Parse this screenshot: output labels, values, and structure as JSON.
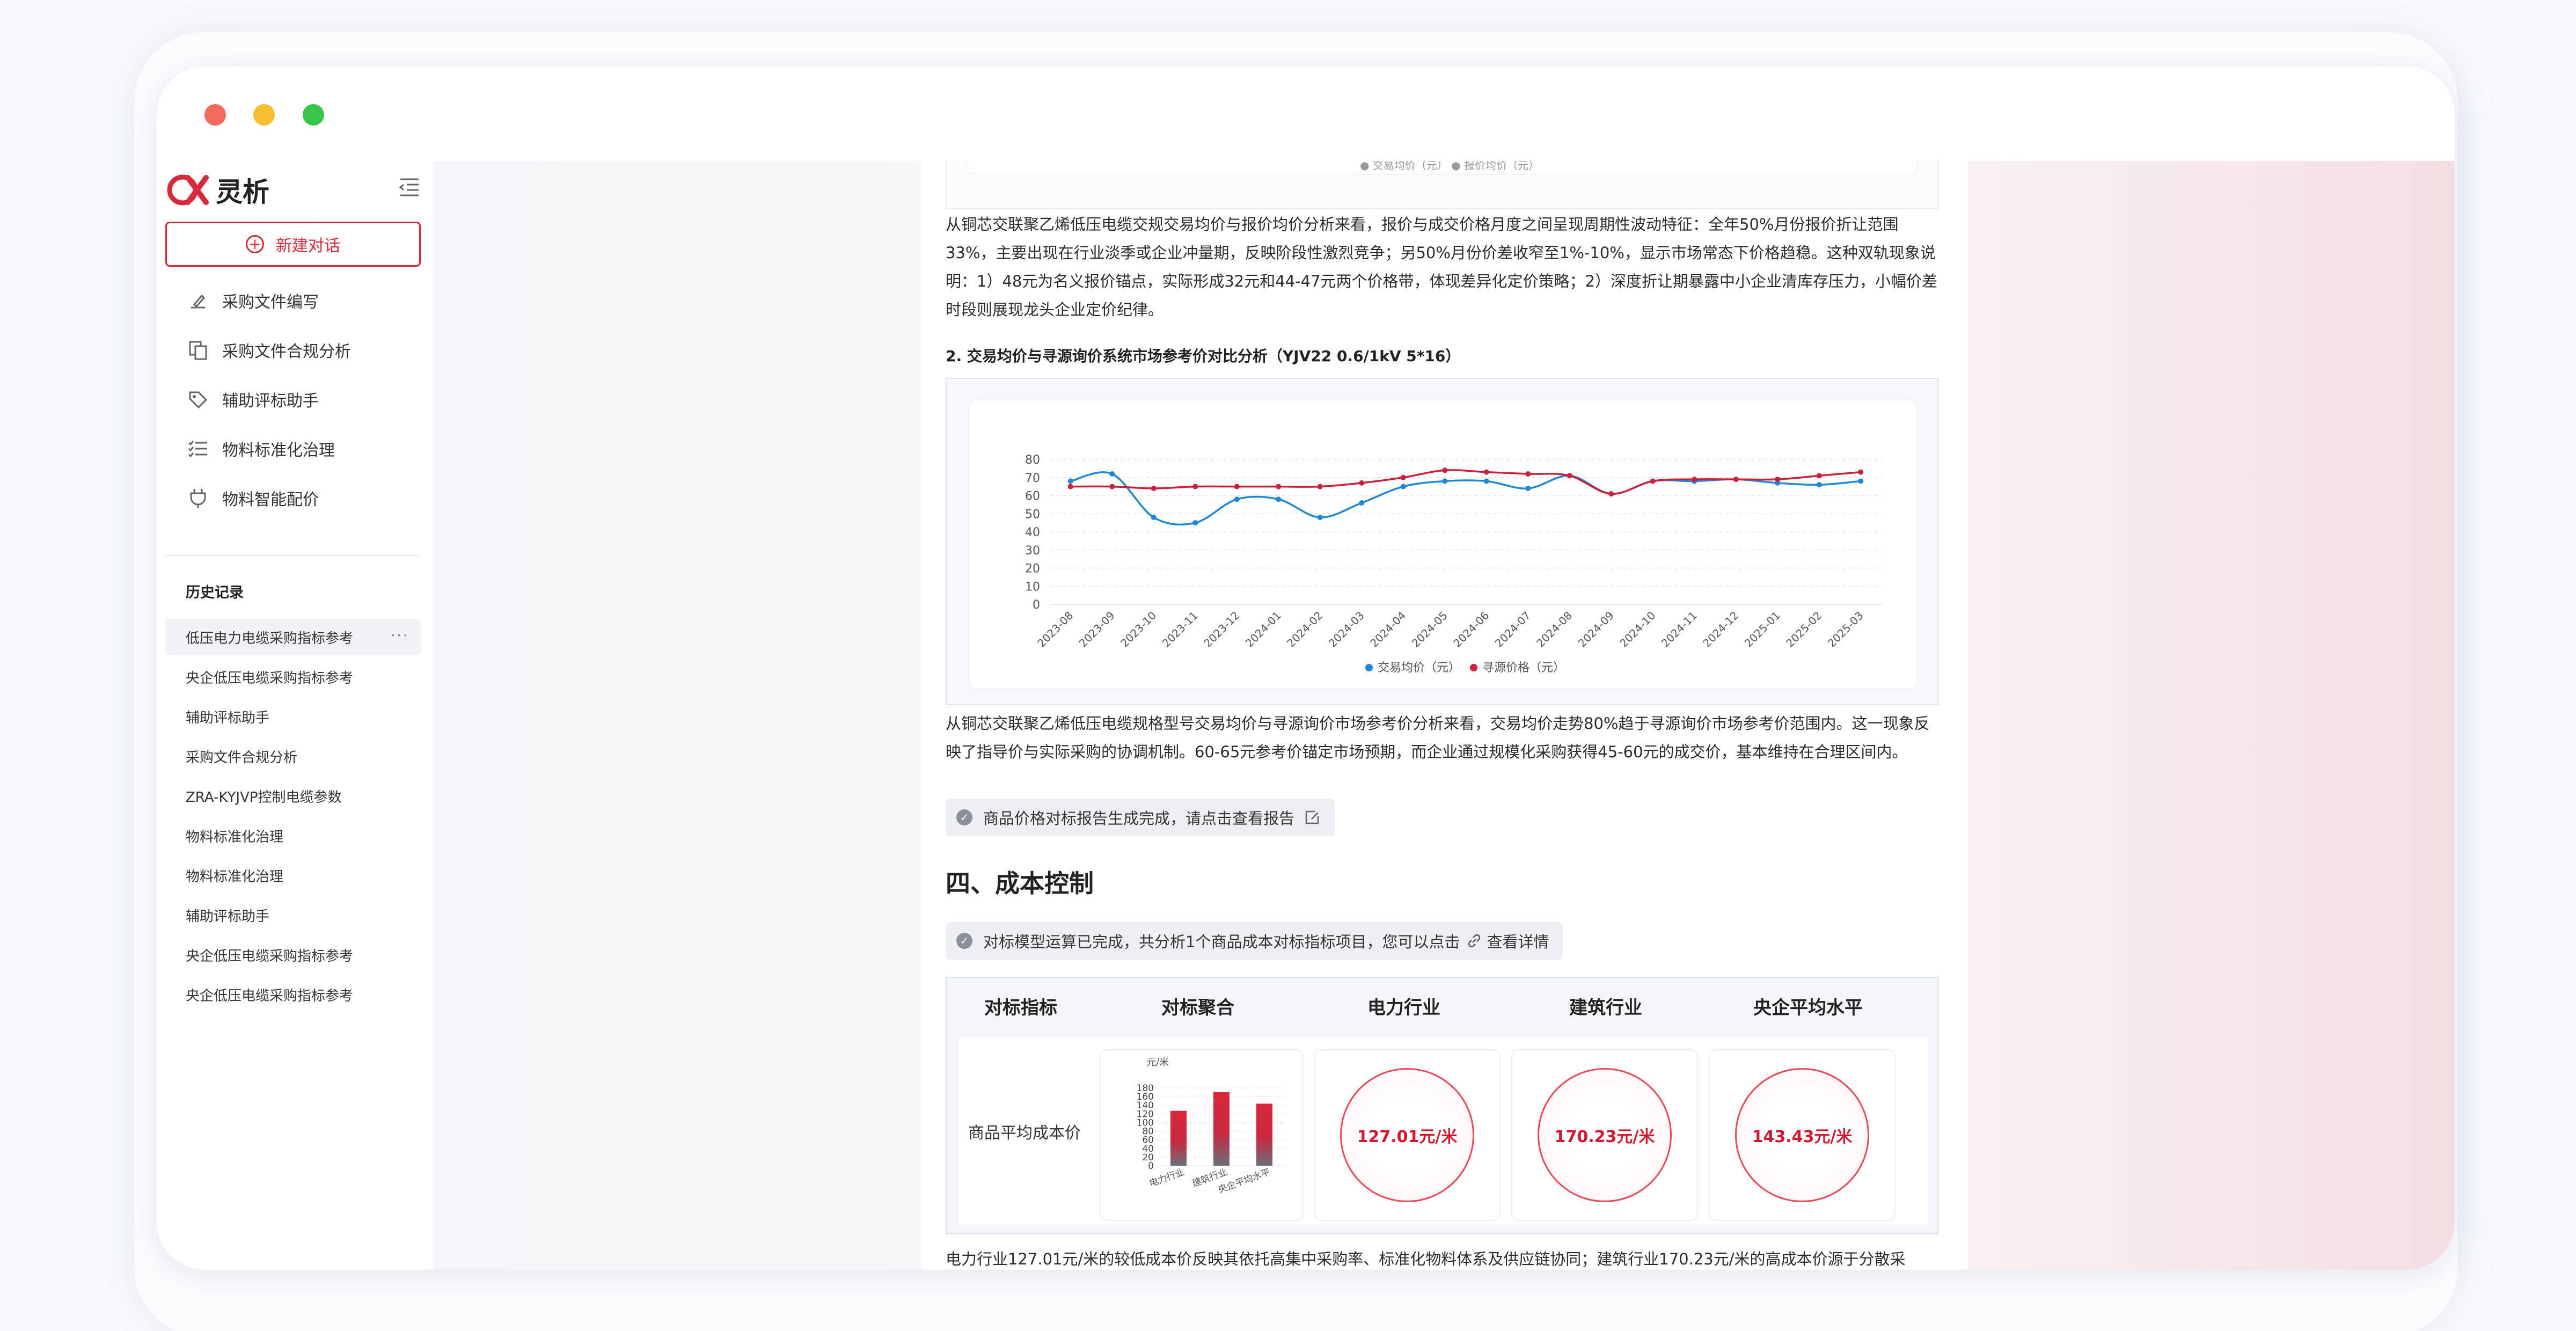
{
  "app": {
    "name": "灵析"
  },
  "sidebar": {
    "new_chat": "新建对话",
    "menu": [
      {
        "label": "采购文件编写",
        "icon": "doc-write-icon"
      },
      {
        "label": "采购文件合规分析",
        "icon": "doc-compliance-icon"
      },
      {
        "label": "辅助评标助手",
        "icon": "tag-icon"
      },
      {
        "label": "物料标准化治理",
        "icon": "list-check-icon"
      },
      {
        "label": "物料智能配价",
        "icon": "plug-icon"
      }
    ],
    "history_title": "历史记录",
    "history": [
      "低压电力电缆采购指标参考",
      "央企低压电缆采购指标参考",
      "辅助评标助手",
      "采购文件合规分析",
      "ZRA-KYJVP控制电缆参数",
      "物料标准化治理",
      "物料标准化治理",
      "辅助评标助手",
      "央企低压电缆采购指标参考",
      "央企低压电缆采购指标参考"
    ],
    "more": "···"
  },
  "article": {
    "prev_legend": "● 交易均价（元）   ● 报价均价（元）",
    "para1": "从铜芯交联聚乙烯低压电缆交规交易均价与报价均价分析来看，报价与成交价格月度之间呈现周期性波动特征：全年50%月份报价折让范围33%，主要出现在行业淡季或企业冲量期，反映阶段性激烈竞争；另50%月份价差收窄至1%-10%，显示市场常态下价格趋稳。这种双轨现象说明：1）48元为名义报价锚点，实际形成32元和44-47元两个价格带，体现差异化定价策略；2）深度折让期暴露中小企业清库存压力，小幅价差时段则展现龙头企业定价纪律。",
    "h2": "2. 交易均价与寻源询价系统市场参考价对比分析（YJV22 0.6/1kV 5*16）",
    "para2": "从铜芯交联聚乙烯低压电缆规格型号交易均价与寻源询价市场参考价分析来看，交易均价走势80%趋于寻源询价市场参考价范围内。这一现象反映了指导价与实际采购的协调机制。60-65元参考价锚定市场预期，而企业通过规模化采购获得45-60元的成交价，基本维持在合理区间内。",
    "notice1": "商品价格对标报告生成完成，请点击查看报告",
    "h4": "四、成本控制",
    "notice2": "对标模型运算已完成，共分析1个商品成本对标指标项目，您可以点击",
    "notice2_link": "查看详情",
    "para3": "电力行业127.01元/米的较低成本价反映其依托高集中采购率、标准化物料体系及供应链协同；建筑行业170.23元/米的高成本价源于分散采"
  },
  "chart_data": {
    "type": "line",
    "x": [
      "2023-08",
      "2023-09",
      "2023-10",
      "2023-11",
      "2023-12",
      "2024-01",
      "2024-02",
      "2024-03",
      "2024-04",
      "2024-05",
      "2024-06",
      "2024-07",
      "2024-08",
      "2024-09",
      "2024-10",
      "2024-11",
      "2024-12",
      "2025-01",
      "2025-02",
      "2025-03"
    ],
    "series": [
      {
        "name": "交易均价（元）",
        "color": "#1e88d6",
        "values": [
          68,
          72,
          48,
          45,
          58,
          58,
          48,
          56,
          65,
          68,
          68,
          64,
          71,
          61,
          68,
          68,
          69,
          67,
          66,
          68
        ]
      },
      {
        "name": "寻源价格（元）",
        "color": "#cc1f3c",
        "values": [
          65,
          65,
          64,
          65,
          65,
          65,
          65,
          67,
          70,
          74,
          73,
          72,
          71,
          61,
          68,
          69,
          69,
          69,
          71,
          73
        ]
      }
    ],
    "yticks": [
      0,
      10,
      20,
      30,
      40,
      50,
      60,
      70,
      80
    ],
    "ylim": [
      0,
      80
    ],
    "grid": true,
    "legend": "bottom"
  },
  "cost_table": {
    "headers": [
      "对标指标",
      "对标聚合",
      "电力行业",
      "建筑行业",
      "央企平均水平"
    ],
    "row_label": "商品平均成本价",
    "mini_chart": {
      "unit": "元/米",
      "yticks": [
        0,
        20,
        40,
        60,
        80,
        100,
        120,
        140,
        160,
        180
      ],
      "categories": [
        "电力行业",
        "建筑行业",
        "央企平均水平"
      ],
      "values": [
        127.01,
        170.23,
        143.43
      ]
    },
    "values": [
      "127.01元/米",
      "170.23元/米",
      "143.43元/米"
    ]
  },
  "colors": {
    "accent": "#d8283a",
    "blue": "#1e88d6",
    "red": "#cc1f3c"
  }
}
